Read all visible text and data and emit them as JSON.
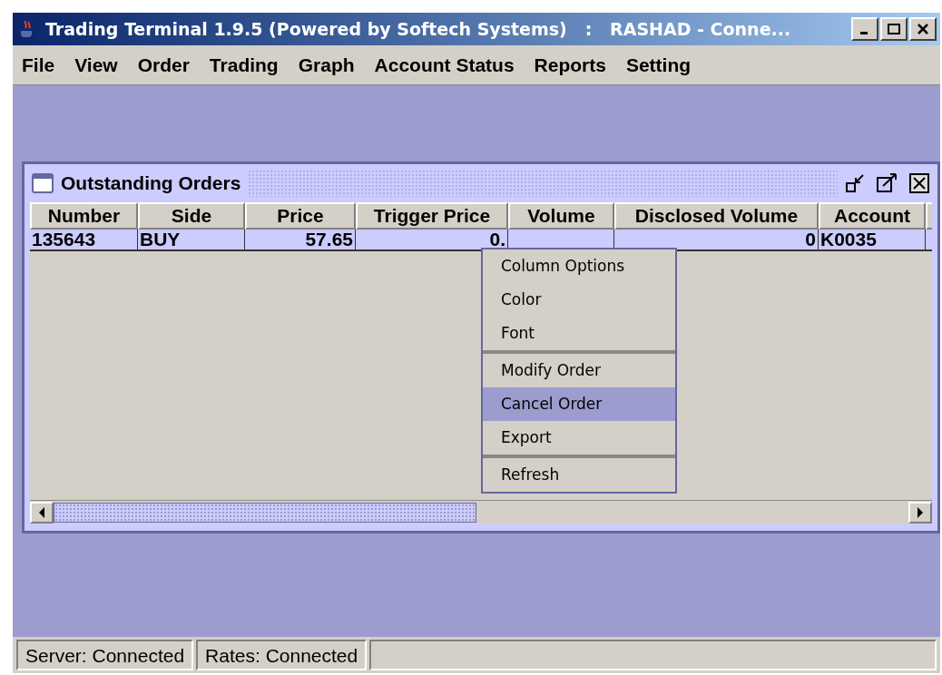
{
  "window": {
    "title": "Trading Terminal 1.9.5 (Powered by Softech Systems)   :   RASHAD - Conne..."
  },
  "menu_bar": [
    "File",
    "View",
    "Order",
    "Trading",
    "Graph",
    "Account Status",
    "Reports",
    "Setting"
  ],
  "orders_window": {
    "title": "Outstanding Orders",
    "columns": [
      "Number",
      "Side",
      "Price",
      "Trigger Price",
      "Volume",
      "Disclosed Volume",
      "Account"
    ],
    "rows": [
      [
        "135643",
        "BUY",
        "57.65",
        "0.",
        "",
        "0",
        "K0035"
      ]
    ]
  },
  "context_menu": [
    {
      "label": "Column Options",
      "selected": false,
      "separator_before": false
    },
    {
      "label": "Color",
      "selected": false,
      "separator_before": false
    },
    {
      "label": "Font",
      "selected": false,
      "separator_before": false
    },
    {
      "label": "Modify Order",
      "selected": false,
      "separator_before": true
    },
    {
      "label": "Cancel Order",
      "selected": true,
      "separator_before": false
    },
    {
      "label": "Export",
      "selected": false,
      "separator_before": false
    },
    {
      "label": "Refresh",
      "selected": false,
      "separator_before": true
    }
  ],
  "status_bar": [
    "Server: Connected",
    "Rates: Connected"
  ]
}
